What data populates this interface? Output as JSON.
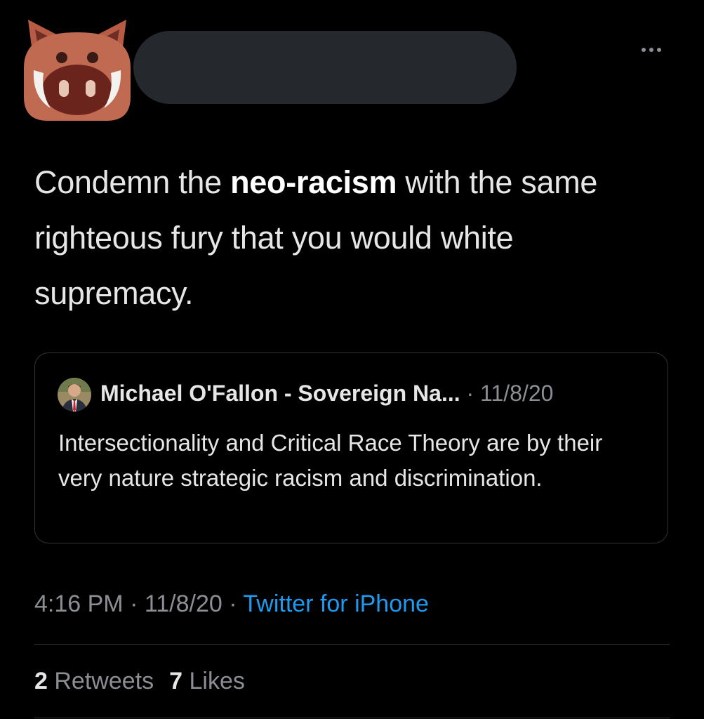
{
  "tweet": {
    "text_part1": "Condemn the ",
    "text_bold": "neo-racism",
    "text_part2": " with the same righteous fury that you would white supremacy."
  },
  "quoted_tweet": {
    "author": "Michael O'Fallon - Sovereign Na...",
    "separator": " · ",
    "date": "11/8/20",
    "text": "Intersectionality and Critical Race Theory are by their very nature strategic racism and discrimination."
  },
  "meta": {
    "time": "4:16 PM",
    "sep1": " · ",
    "date": "11/8/20",
    "sep2": " · ",
    "source": "Twitter for iPhone"
  },
  "stats": {
    "retweets_count": "2",
    "retweets_label": " Retweets",
    "likes_count": "7",
    "likes_label": " Likes"
  },
  "icons": {
    "avatar": "boar-face-icon",
    "more": "more-options-icon"
  },
  "colors": {
    "background": "#000000",
    "link": "#1d9bf0",
    "muted": "#8b8f94",
    "redaction": "#25282c",
    "boar": "#b85b45"
  }
}
